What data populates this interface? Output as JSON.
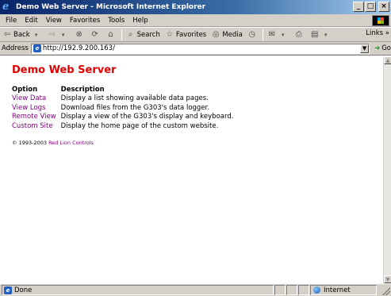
{
  "window": {
    "title": "Demo Web Server - Microsoft Internet Explorer",
    "min_label": "_",
    "max_label": "□",
    "close_label": "×"
  },
  "menu": [
    "File",
    "Edit",
    "View",
    "Favorites",
    "Tools",
    "Help"
  ],
  "toolbar": {
    "back_label": "Back",
    "search_label": "Search",
    "favorites_label": "Favorites",
    "media_label": "Media",
    "links_label": "Links »"
  },
  "address": {
    "label": "Address",
    "url": "http://192.9.200.163/",
    "go_label": "Go"
  },
  "page": {
    "title": "Demo Web Server",
    "col_option": "Option",
    "col_description": "Description",
    "rows": [
      {
        "option": "View Data",
        "description": "Display a list showing available data pages."
      },
      {
        "option": "View Logs",
        "description": "Download files from the G303's data logger."
      },
      {
        "option": "Remote View",
        "description": "Display a view of the G303's display and keyboard."
      },
      {
        "option": "Custom Site",
        "description": "Display the home page of the custom website."
      }
    ],
    "copyright_prefix": "© 1993-2003",
    "copyright_link": "Red Lion Controls"
  },
  "status": {
    "text": "Done",
    "zone": "Internet"
  },
  "colors": {
    "title_red": "#e00000",
    "link_visited": "#800080"
  }
}
